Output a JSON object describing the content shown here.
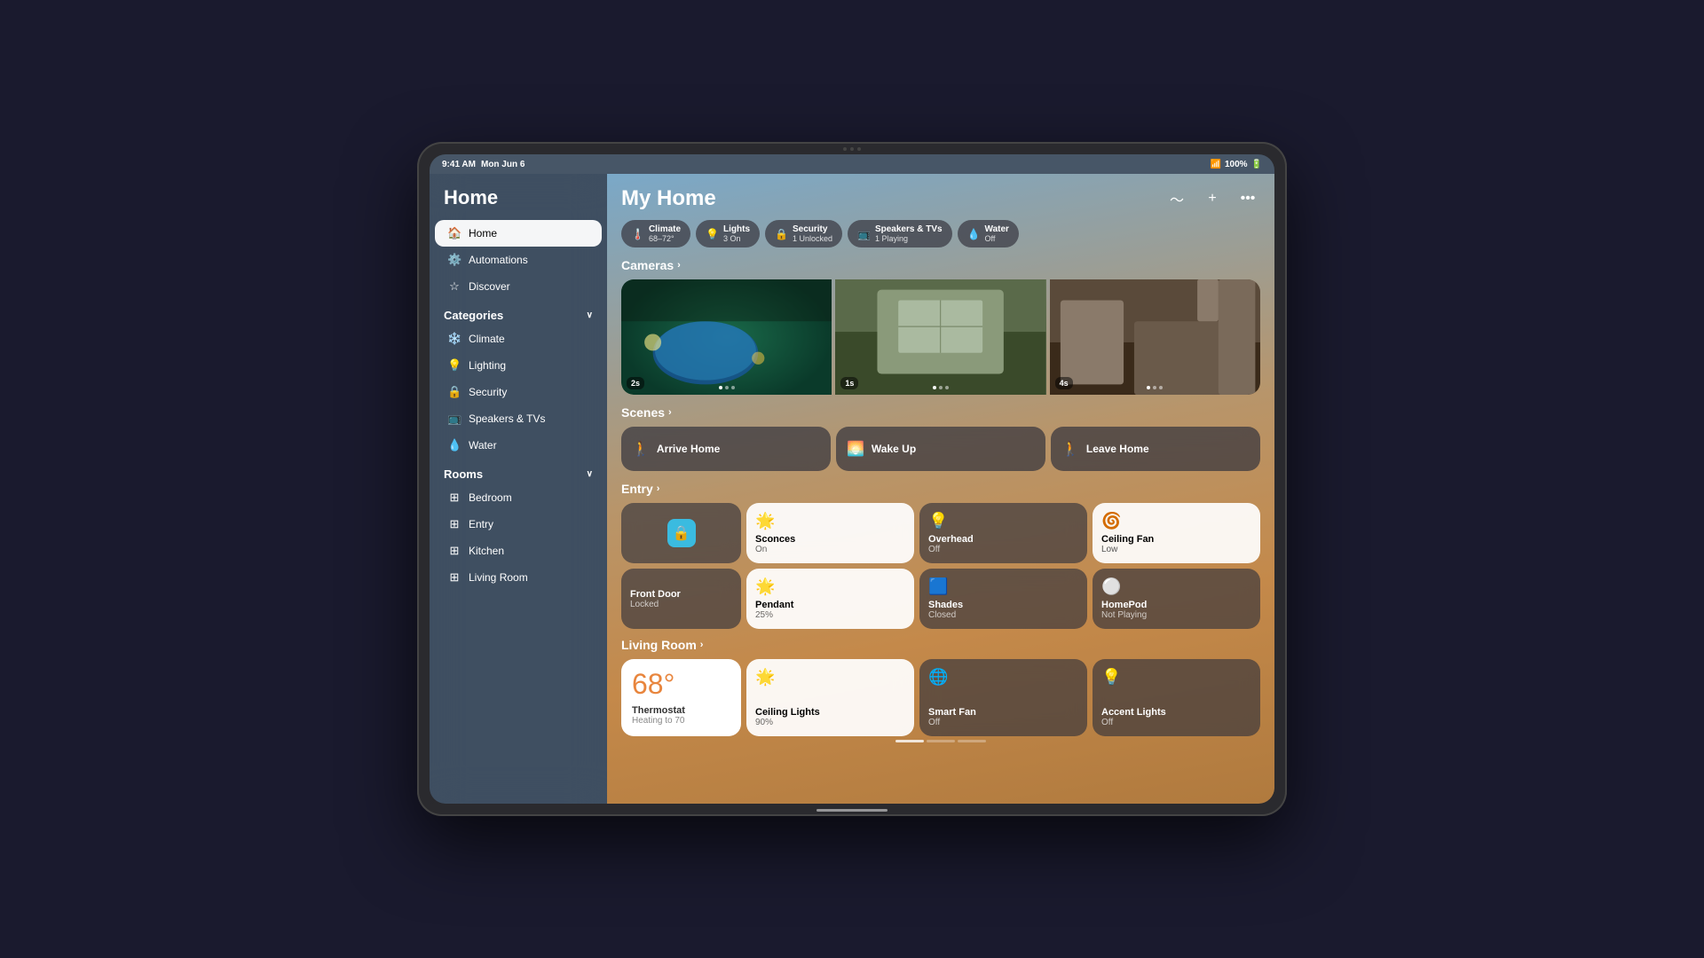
{
  "statusBar": {
    "time": "9:41 AM",
    "date": "Mon Jun 6",
    "wifi": "WiFi",
    "battery": "100%"
  },
  "header": {
    "menuDots": "•••",
    "title": "My Home",
    "actions": [
      "waveform",
      "plus",
      "ellipsis"
    ]
  },
  "pills": [
    {
      "id": "climate",
      "icon": "🌡️",
      "title": "Climate",
      "sub": "68–72°"
    },
    {
      "id": "lights",
      "icon": "💡",
      "title": "Lights",
      "sub": "3 On"
    },
    {
      "id": "security",
      "icon": "🔒",
      "title": "Security",
      "sub": "1 Unlocked"
    },
    {
      "id": "speakers",
      "icon": "📺",
      "title": "Speakers & TVs",
      "sub": "1 Playing"
    },
    {
      "id": "water",
      "icon": "💧",
      "title": "Water",
      "sub": "Off"
    }
  ],
  "cameras": {
    "label": "Cameras",
    "items": [
      {
        "id": "cam1",
        "label": "2s",
        "type": "pool",
        "activeDot": 1,
        "dots": 3
      },
      {
        "id": "cam2",
        "label": "1s",
        "type": "garage",
        "activeDot": 1,
        "dots": 3
      },
      {
        "id": "cam3",
        "label": "4s",
        "type": "bedroom",
        "activeDot": 1,
        "dots": 3
      }
    ]
  },
  "scenes": {
    "label": "Scenes",
    "items": [
      {
        "id": "arrive",
        "icon": "🚶",
        "label": "Arrive Home"
      },
      {
        "id": "wakeup",
        "icon": "🌅",
        "label": "Wake Up"
      },
      {
        "id": "leave",
        "icon": "🚶",
        "label": "Leave Home"
      }
    ]
  },
  "entry": {
    "label": "Entry",
    "row1": [
      {
        "id": "frontdoor-lock",
        "type": "lock",
        "icon": "🔒",
        "name": "",
        "state": ""
      },
      {
        "id": "sconces",
        "type": "active",
        "icon": "🔆",
        "name": "Sconces",
        "state": "On"
      },
      {
        "id": "overhead",
        "type": "normal",
        "icon": "💡",
        "name": "Overhead",
        "state": "Off"
      },
      {
        "id": "ceilingfan",
        "type": "active-blue",
        "icon": "🌀",
        "name": "Ceiling Fan",
        "state": "Low"
      }
    ],
    "row2label": "Front Door",
    "row2sublabel": "Locked",
    "row2": [
      {
        "id": "pendant",
        "type": "active",
        "icon": "🔆",
        "name": "Pendant",
        "state": "25%"
      },
      {
        "id": "shades",
        "type": "normal",
        "icon": "🟦",
        "name": "Shades",
        "state": "Closed"
      },
      {
        "id": "homepod",
        "type": "normal",
        "icon": "⚪",
        "name": "HomePod",
        "state": "Not Playing"
      }
    ]
  },
  "livingRoom": {
    "label": "Living Room",
    "row1": [
      {
        "id": "thermostat",
        "type": "thermostat",
        "temp": "68°",
        "name": "Thermostat",
        "state": "Heating to 70"
      },
      {
        "id": "ceilinglights",
        "type": "active",
        "icon": "🔆",
        "name": "Ceiling Lights",
        "state": "90%"
      },
      {
        "id": "smartfan",
        "type": "normal",
        "icon": "🌐",
        "name": "Smart Fan",
        "state": "Off"
      },
      {
        "id": "accentlights",
        "type": "normal",
        "icon": "💡",
        "name": "Accent Lights",
        "state": "Off"
      }
    ]
  },
  "sidebar": {
    "title": "Home",
    "nav": [
      {
        "id": "home",
        "icon": "🏠",
        "label": "Home",
        "active": true
      },
      {
        "id": "automations",
        "icon": "⚙️",
        "label": "Automations",
        "active": false
      },
      {
        "id": "discover",
        "icon": "⭐",
        "label": "Discover",
        "active": false
      }
    ],
    "categories": {
      "label": "Categories",
      "items": [
        {
          "id": "climate",
          "icon": "❄️",
          "label": "Climate"
        },
        {
          "id": "lighting",
          "icon": "💡",
          "label": "Lighting"
        },
        {
          "id": "security",
          "icon": "🔒",
          "label": "Security"
        },
        {
          "id": "speakers",
          "icon": "📺",
          "label": "Speakers & TVs"
        },
        {
          "id": "water",
          "icon": "💧",
          "label": "Water"
        }
      ]
    },
    "rooms": {
      "label": "Rooms",
      "items": [
        {
          "id": "bedroom",
          "icon": "⊞",
          "label": "Bedroom"
        },
        {
          "id": "entry",
          "icon": "⊞",
          "label": "Entry"
        },
        {
          "id": "kitchen",
          "icon": "⊞",
          "label": "Kitchen"
        },
        {
          "id": "livingroom",
          "icon": "⊞",
          "label": "Living Room"
        }
      ]
    }
  }
}
